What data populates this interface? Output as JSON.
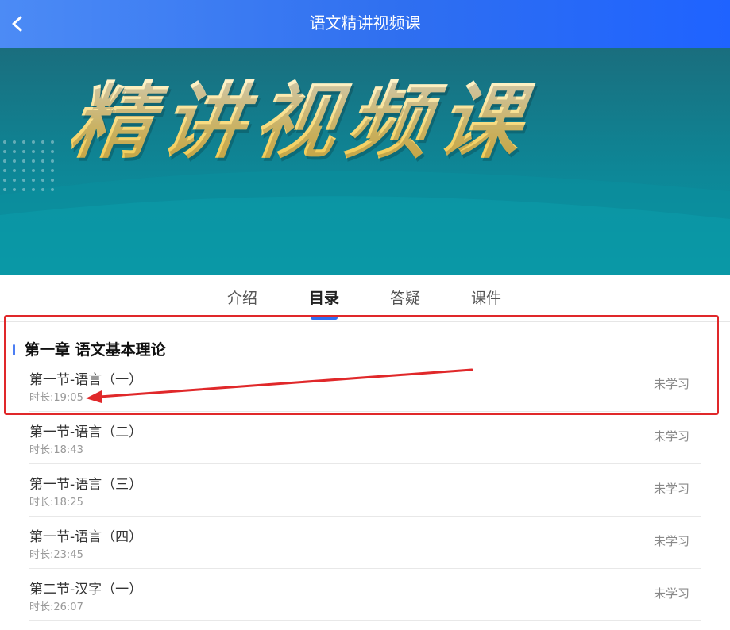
{
  "header": {
    "title": "语文精讲视频课",
    "back_icon": "chevron-left-icon"
  },
  "banner": {
    "title": "精讲视频课"
  },
  "tabs": [
    {
      "label": "介绍",
      "active": false
    },
    {
      "label": "目录",
      "active": true
    },
    {
      "label": "答疑",
      "active": false
    },
    {
      "label": "课件",
      "active": false
    }
  ],
  "chapter": {
    "title": "第一章 语文基本理论"
  },
  "lessons": [
    {
      "title": "第一节-语言（一）",
      "duration": "时长:19:05",
      "status": "未学习"
    },
    {
      "title": "第一节-语言（二）",
      "duration": "时长:18:43",
      "status": "未学习"
    },
    {
      "title": "第一节-语言（三）",
      "duration": "时长:18:25",
      "status": "未学习"
    },
    {
      "title": "第一节-语言（四）",
      "duration": "时长:23:45",
      "status": "未学习"
    },
    {
      "title": "第二节-汉字（一）",
      "duration": "时长:26:07",
      "status": "未学习"
    }
  ],
  "colors": {
    "header_blue": "#2f6ff0",
    "banner_teal": "#0d8797",
    "banner_text": "#f6d774",
    "annotation_red": "#e0282a"
  }
}
